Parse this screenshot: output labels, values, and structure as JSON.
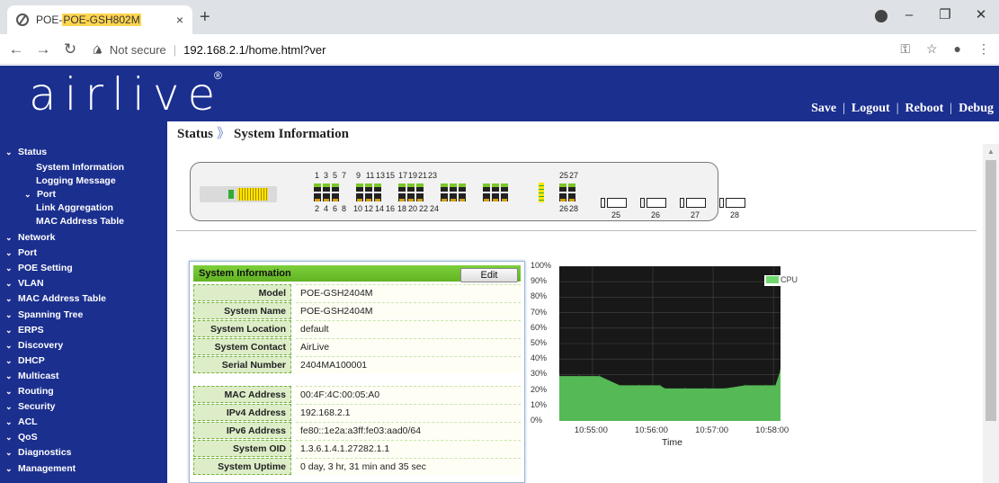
{
  "browser": {
    "tab_title_prefix": "POE-",
    "tab_title_highlight": "POE-GSH802M",
    "tab_close": "×",
    "new_tab": "+",
    "not_secure": "Not secure",
    "url": "192.168.2.1/home.html?ver"
  },
  "header": {
    "logo": "airlive",
    "registered": "®",
    "links": [
      "Save",
      "Logout",
      "Reboot",
      "Debug"
    ]
  },
  "breadcrumb": {
    "section": "Status",
    "separator": "》",
    "page": "System Information"
  },
  "sidebar": {
    "status": "Status",
    "status_children": [
      "System Information",
      "Logging Message"
    ],
    "port_group": "Port",
    "port_children": [
      "Link Aggregation",
      "MAC Address Table"
    ],
    "menus": [
      "Network",
      "Port",
      "POE Setting",
      "VLAN",
      "MAC Address Table",
      "Spanning Tree",
      "ERPS",
      "Discovery",
      "DHCP",
      "Multicast",
      "Routing",
      "Security",
      "ACL",
      "QoS",
      "Diagnostics",
      "Management"
    ]
  },
  "panel": {
    "top_odd": [
      "1",
      "3",
      "5",
      "7",
      "9",
      "11",
      "13",
      "15",
      "17",
      "19",
      "21",
      "23",
      "25",
      "27"
    ],
    "bottom_even": [
      "2",
      "4",
      "6",
      "8",
      "10",
      "12",
      "14",
      "16",
      "18",
      "20",
      "22",
      "24",
      "26",
      "28"
    ],
    "sfp_ports": [
      "25",
      "26",
      "27",
      "28"
    ]
  },
  "system_info": {
    "title": "System Information",
    "edit_label": "Edit",
    "rows_a": [
      {
        "label": "Model",
        "value": "POE-GSH2404M"
      },
      {
        "label": "System Name",
        "value": "POE-GSH2404M"
      },
      {
        "label": "System Location",
        "value": "default"
      },
      {
        "label": "System Contact",
        "value": "AirLive"
      },
      {
        "label": "Serial Number",
        "value": "2404MA100001"
      }
    ],
    "rows_b": [
      {
        "label": "MAC Address",
        "value": "00:4F:4C:00:05:A0"
      },
      {
        "label": "IPv4 Address",
        "value": "192.168.2.1"
      },
      {
        "label": "IPv6 Address",
        "value": "fe80::1e2a:a3ff:fe03:aad0/64"
      },
      {
        "label": "System OID",
        "value": "1.3.6.1.4.1.27282.1.1"
      },
      {
        "label": "System Uptime",
        "value": "0 day, 3 hr, 31 min and 35 sec"
      }
    ]
  },
  "chart_data": {
    "type": "area",
    "title": "",
    "xlabel": "Time",
    "ylabel": "",
    "y_ticks": [
      "100%",
      "90%",
      "80%",
      "70%",
      "60%",
      "50%",
      "40%",
      "30%",
      "20%",
      "10%",
      "0%"
    ],
    "x_ticks": [
      "10:55:00",
      "10:56:00",
      "10:57:00",
      "10:58:00"
    ],
    "ylim": [
      0,
      100
    ],
    "grid": true,
    "legend_position": "top-right",
    "series": [
      {
        "name": "CPU",
        "color": "#55b955",
        "x": [
          "10:54:27",
          "10:54:47",
          "10:55:07",
          "10:55:27",
          "10:55:47",
          "10:56:07",
          "10:56:12",
          "10:56:32",
          "10:56:52",
          "10:57:12",
          "10:57:32",
          "10:57:52",
          "10:58:02",
          "10:58:07"
        ],
        "y": [
          29,
          29,
          29,
          23,
          23,
          23,
          21,
          21,
          21,
          21,
          23,
          23,
          23,
          33
        ]
      }
    ]
  }
}
